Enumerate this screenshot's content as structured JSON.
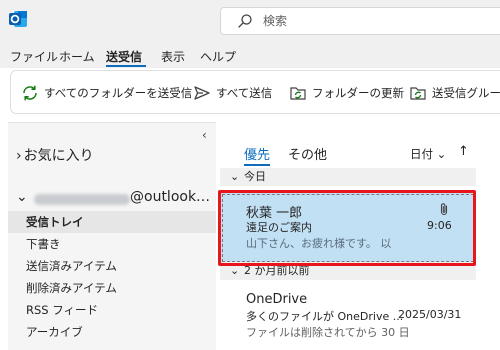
{
  "search": {
    "placeholder": "検索"
  },
  "menu": {
    "tabs": [
      {
        "label": "ファイル"
      },
      {
        "label": "ホーム"
      },
      {
        "label": "送受信",
        "active": true
      },
      {
        "label": "表示"
      },
      {
        "label": "ヘルプ"
      }
    ]
  },
  "ribbon": {
    "buttons": [
      {
        "label": "すべてのフォルダーを送受信",
        "icon": "sync-icon"
      },
      {
        "label": "すべて送信",
        "icon": "send-icon"
      },
      {
        "label": "フォルダーの更新",
        "icon": "folder-refresh-icon"
      },
      {
        "label": "送受信グルー",
        "icon": "send-receive-group-icon"
      }
    ]
  },
  "folders": {
    "collapse_glyph": "‹",
    "favorites_label": "お気に入り",
    "account_domain": "@outlook…",
    "items": [
      {
        "label": "受信トレイ",
        "selected": true
      },
      {
        "label": "下書き"
      },
      {
        "label": "送信済みアイテム"
      },
      {
        "label": "削除済みアイテム"
      },
      {
        "label": "RSS フィード"
      },
      {
        "label": "アーカイブ"
      }
    ]
  },
  "messagelist": {
    "tabs": [
      {
        "label": "優先",
        "active": true
      },
      {
        "label": "その他"
      }
    ],
    "sort_label": "日付 ⌄",
    "sort_direction": "↑",
    "groups": [
      {
        "label": "今日",
        "messages": [
          {
            "sender": "秋葉 一郎",
            "subject": "遠足のご案内",
            "preview": "山下さん、お疲れ様です。 以",
            "time": "9:06",
            "has_attachment": true,
            "selected": true
          }
        ]
      },
      {
        "label": "2 か月前以前",
        "messages": [
          {
            "sender": "OneDrive",
            "subject": "多くのファイルが OneDrive ...",
            "preview": "ファイルは削除されてから 30 日",
            "time": "2025/03/31"
          }
        ]
      }
    ]
  },
  "colors": {
    "accent": "#0f6cbd",
    "selection": "#c2e0f4",
    "highlight_border": "#e8161b"
  }
}
